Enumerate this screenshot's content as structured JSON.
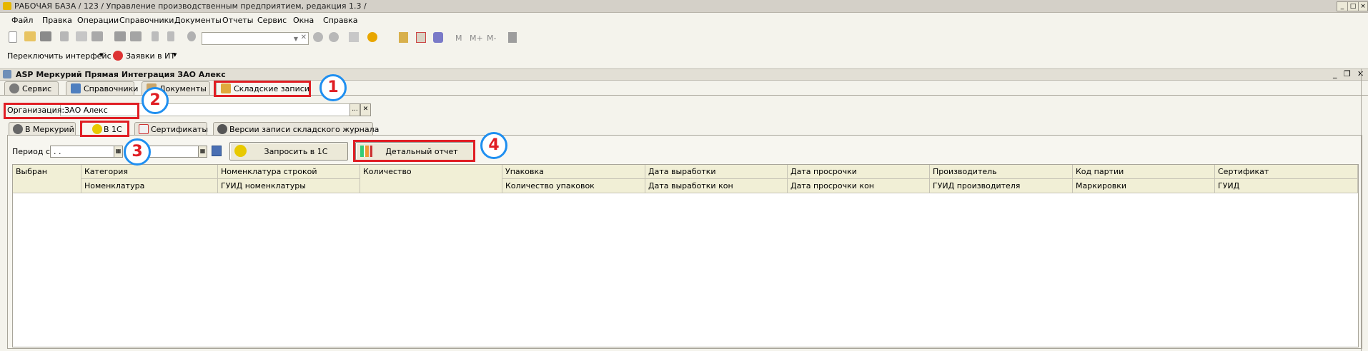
{
  "app": {
    "title": "РАБОЧАЯ БАЗА / 123 /  Управление производственным предприятием, редакция 1.3 /"
  },
  "menu": [
    "Файл",
    "Правка",
    "Операции",
    "Справочники",
    "Документы",
    "Отчеты",
    "Сервис",
    "Окна",
    "Справка"
  ],
  "toolbar2": {
    "switch_interface": "Переключить интерфейс",
    "requests": "Заявки в ИТ"
  },
  "form": {
    "title": "ASP Меркурий Прямая Интеграция ЗАО Алекс",
    "tabs": [
      "Сервис",
      "Справочники",
      "Документы",
      "Складские записи"
    ],
    "org_label": "Организация:",
    "org_value": "ЗАО Алекс",
    "subtabs": [
      "В Меркурий",
      "В 1С",
      "Сертификаты",
      "Версии записи складского журнала"
    ],
    "period_label": "Период с:",
    "date_from": " .  .",
    "request_button": "Запросить в 1С",
    "report_button": "Детальный отчет",
    "columns_row1": [
      "Выбран",
      "Категория",
      "Номенклатура строкой",
      "Количество",
      "Упаковка",
      "Дата выработки",
      "Дата просрочки",
      "Производитель",
      "Код партии",
      "Сертификат"
    ],
    "columns_row2": [
      "",
      "Номенклатура",
      "ГУИД номенклатуры",
      "",
      "Количество упаковок",
      "Дата выработки кон",
      "Дата просрочки кон",
      "ГУИД производителя",
      "Маркировки",
      "ГУИД"
    ]
  },
  "annotations": [
    "1",
    "2",
    "3",
    "4"
  ],
  "colors": {
    "annotation_red": "#e01e24",
    "annotation_blue": "#1f8ff0",
    "grid_header": "#f1efd6"
  }
}
